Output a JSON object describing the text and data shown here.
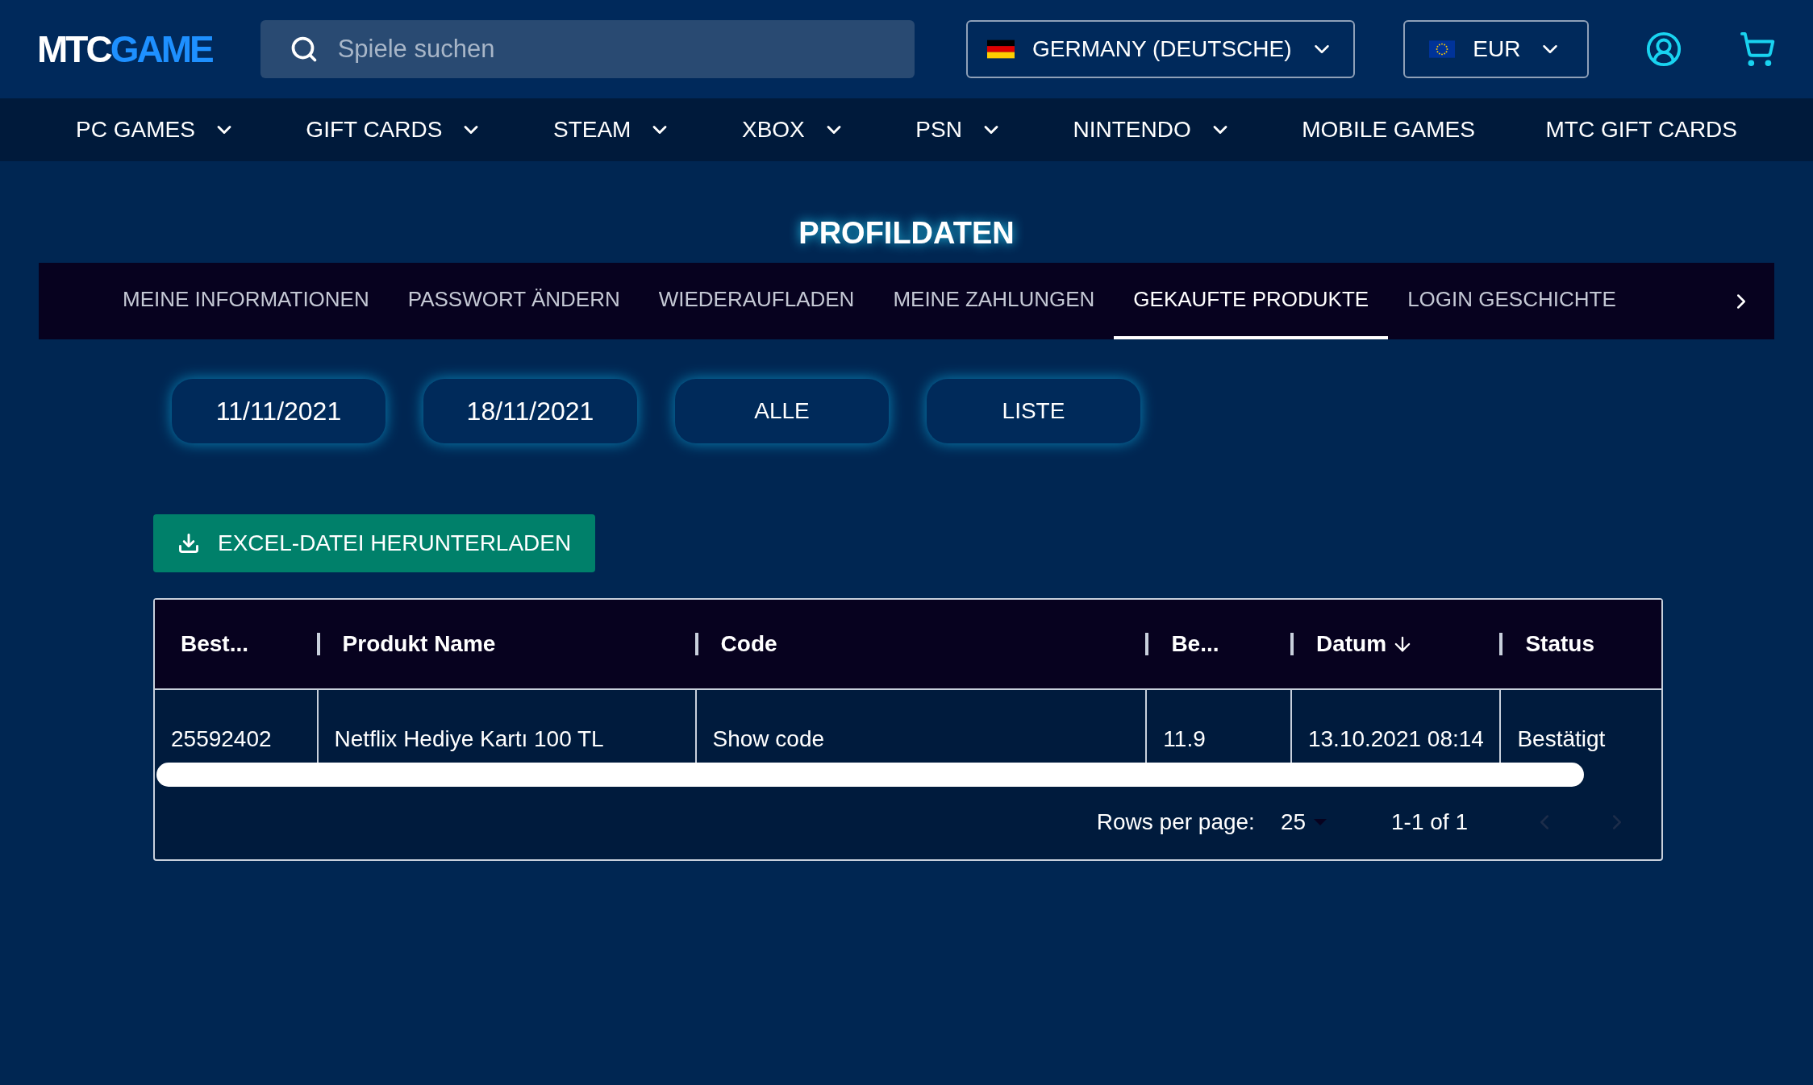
{
  "header": {
    "logo": {
      "part_1": "MTC",
      "part_2": "GAME"
    },
    "search": {
      "placeholder": "Spiele suchen"
    },
    "country": {
      "label": "GERMANY (DEUTSCHE)"
    },
    "currency": {
      "label": "EUR"
    }
  },
  "nav": [
    {
      "label": "PC GAMES",
      "has_menu": true
    },
    {
      "label": "GIFT CARDS",
      "has_menu": true
    },
    {
      "label": "STEAM",
      "has_menu": true
    },
    {
      "label": "XBOX",
      "has_menu": true
    },
    {
      "label": "PSN",
      "has_menu": true
    },
    {
      "label": "NINTENDO",
      "has_menu": true
    },
    {
      "label": "MOBILE GAMES",
      "has_menu": false
    },
    {
      "label": "MTC GIFT CARDS",
      "has_menu": false
    }
  ],
  "page_title": "PROFILDATEN",
  "tabs": [
    {
      "label": "MEINE INFORMATIONEN",
      "selected": false
    },
    {
      "label": "PASSWORT ÄNDERN",
      "selected": false
    },
    {
      "label": "WIEDERAUFLADEN",
      "selected": false
    },
    {
      "label": "MEINE ZAHLUNGEN",
      "selected": false
    },
    {
      "label": "GEKAUFTE PRODUKTE",
      "selected": true
    },
    {
      "label": "LOGIN GESCHICHTE",
      "selected": false
    }
  ],
  "filters": [
    {
      "label": "11/11/2021",
      "kind": "date"
    },
    {
      "label": "18/11/2021",
      "kind": "date"
    },
    {
      "label": "ALLE",
      "kind": "option"
    },
    {
      "label": "LISTE",
      "kind": "option"
    }
  ],
  "download_button": "EXCEL-DATEI HERUNTERLADEN",
  "table": {
    "columns": [
      {
        "label": "Best...",
        "sorted": false
      },
      {
        "label": "Produkt Name",
        "sorted": false
      },
      {
        "label": "Code",
        "sorted": false
      },
      {
        "label": "Be...",
        "sorted": false
      },
      {
        "label": "Datum",
        "sorted": true
      },
      {
        "label": "Status",
        "sorted": false
      }
    ],
    "rows": [
      [
        "25592402",
        "Netflix Hediye Kartı 100 TL",
        "Show code",
        "11.9",
        "13.10.2021 08:14",
        "Bestätigt"
      ]
    ]
  },
  "pagination": {
    "rows_per_page_label": "Rows per page:",
    "rows_per_page": "25",
    "range": "1-1 of 1",
    "prev_disabled": true,
    "next_disabled": true
  }
}
